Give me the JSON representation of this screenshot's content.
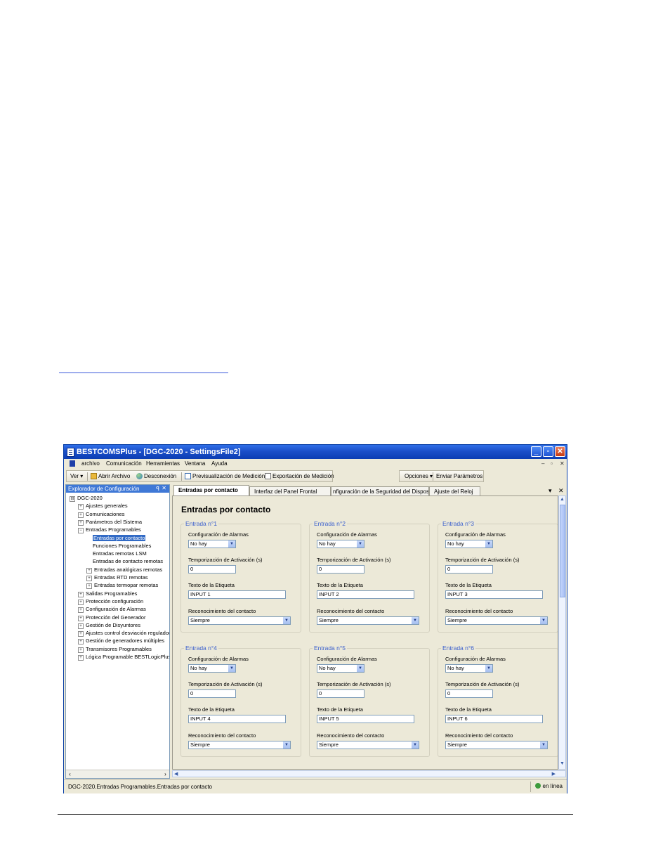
{
  "window": {
    "title": "BESTCOMSPlus - [DGC-2020 - SettingsFile2]",
    "controls": {
      "minimize": "_",
      "maximize": "▫",
      "close": "✕"
    }
  },
  "menubar": {
    "items": [
      "archivo",
      "Comunicación",
      "Herramientas",
      "Ventana",
      "Ayuda"
    ],
    "mdi_controls": [
      "–",
      "▫",
      "✕"
    ]
  },
  "toolbar": {
    "view": "Ver ▾",
    "open_file": "Abrir Archivo",
    "disconnect": "Desconexión",
    "metering_preview": "Previsualización de Medición",
    "metering_export": "Exportación de Medición",
    "options": "Opciones ▾",
    "send_settings": "Enviar Parámetros"
  },
  "explorer": {
    "title": "Explorador de Configuración",
    "pin": "ꟼ",
    "close": "✕",
    "nodes": [
      {
        "label": "DGC-2020",
        "expander": "⊟"
      },
      {
        "label": "Ajustes generales",
        "expander": "+"
      },
      {
        "label": "Comunicaciones",
        "expander": "+"
      },
      {
        "label": "Parámetros del Sistema",
        "expander": "+"
      },
      {
        "label": "Entradas Programables",
        "expander": "−"
      },
      {
        "label": "Entradas por contacto",
        "expander": ""
      },
      {
        "label": "Funciones Programables",
        "expander": ""
      },
      {
        "label": "Entradas remotas LSM",
        "expander": ""
      },
      {
        "label": "Entradas de contacto remotas",
        "expander": ""
      },
      {
        "label": "Entradas analógicas remotas",
        "expander": "+"
      },
      {
        "label": "Entradas RTD remotas",
        "expander": "+"
      },
      {
        "label": "Entradas termopar remotas",
        "expander": "+"
      },
      {
        "label": "Salidas Programables",
        "expander": "+"
      },
      {
        "label": "Protección configuración",
        "expander": "+"
      },
      {
        "label": "Configuración de Alarmas",
        "expander": "+"
      },
      {
        "label": "Protección del Generador",
        "expander": "+"
      },
      {
        "label": "Gestión de Disyuntores",
        "expander": "+"
      },
      {
        "label": "Ajustes control desviación regulador",
        "expander": "+"
      },
      {
        "label": "Gestión de generadores múltiples",
        "expander": "+"
      },
      {
        "label": "Transmisores Programables",
        "expander": "+"
      },
      {
        "label": "Lógica Programable BESTLogicPlus",
        "expander": "+"
      }
    ],
    "selected_index": 5
  },
  "tabs": [
    "Entradas por contacto",
    "Interfaz del Panel Frontal",
    "nfiguración de la Seguridad del Dispositi",
    "Ajuste del Reloj"
  ],
  "tab_controls": {
    "dropdown": "▾",
    "close": "✕"
  },
  "page_title": "Entradas por contacto",
  "field_labels": {
    "alarm_config": "Configuración de Alarmas",
    "activation_delay": "Temporización de Activación (s)",
    "label_text": "Texto de la Etiqueta",
    "contact_recognition": "Reconocimiento del contacto"
  },
  "inputs": [
    {
      "legend": "Entrada n°1",
      "alarm": "No hay",
      "delay": "0",
      "label": "INPUT 1",
      "recognition": "Siempre"
    },
    {
      "legend": "Entrada n°2",
      "alarm": "No hay",
      "delay": "0",
      "label": "INPUT 2",
      "recognition": "Siempre"
    },
    {
      "legend": "Entrada n°3",
      "alarm": "No hay",
      "delay": "0",
      "label": "INPUT 3",
      "recognition": "Siempre"
    },
    {
      "legend": "Entrada n°4",
      "alarm": "No hay",
      "delay": "0",
      "label": "INPUT 4",
      "recognition": "Siempre"
    },
    {
      "legend": "Entrada n°5",
      "alarm": "No hay",
      "delay": "0",
      "label": "INPUT 5",
      "recognition": "Siempre"
    },
    {
      "legend": "Entrada n°6",
      "alarm": "No hay",
      "delay": "0",
      "label": "INPUT 6",
      "recognition": "Siempre"
    }
  ],
  "statusbar": {
    "path": "DGC-2020.Entradas Programables.Entradas por contacto",
    "connection": "en línea"
  },
  "colors": {
    "title_bar": "#1b4fc9",
    "legend": "#3a5fcd",
    "selection": "#316ac5"
  }
}
